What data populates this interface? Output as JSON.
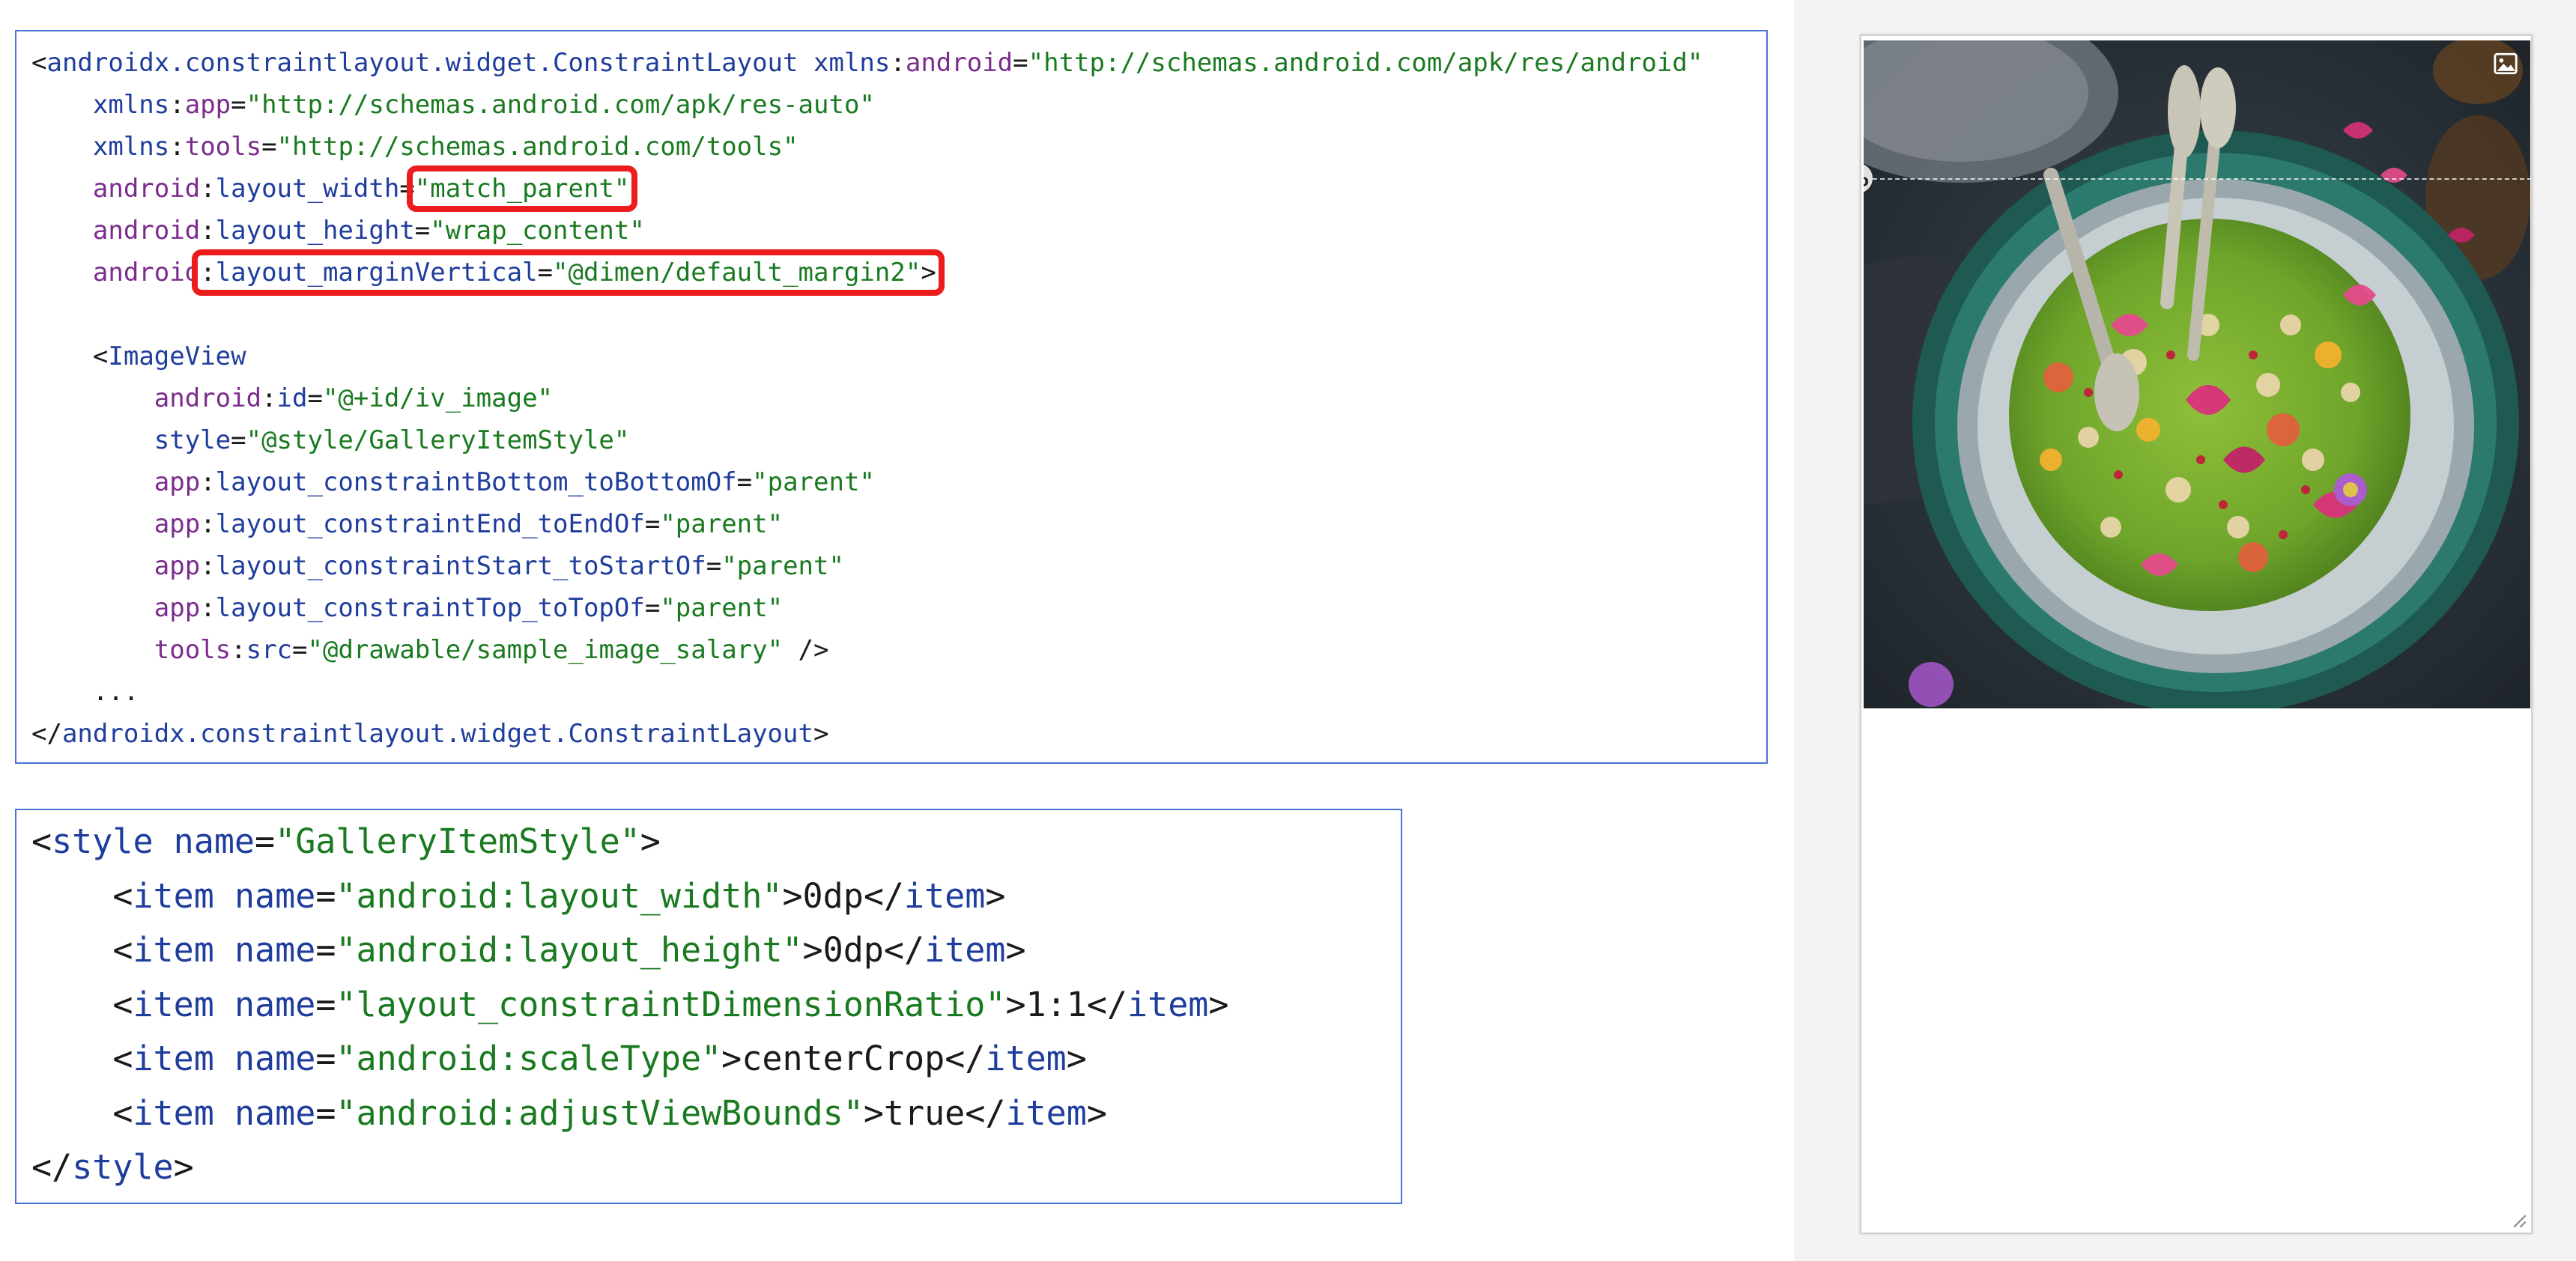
{
  "layout_xml": {
    "line1": {
      "open": "<",
      "tag": "androidx.constraintlayout.widget.ConstraintLayout",
      "sp": " ",
      "attr_ns": "xmlns",
      "attr_sep": ":",
      "attr_name": "android",
      "eq": "=",
      "value": "\"http://schemas.android.com/apk/res/android\""
    },
    "line2": {
      "ns": "xmlns",
      "sep": ":",
      "name": "app",
      "eq": "=",
      "value": "\"http://schemas.android.com/apk/res-auto\""
    },
    "line3": {
      "ns": "xmlns",
      "sep": ":",
      "name": "tools",
      "eq": "=",
      "value": "\"http://schemas.android.com/tools\""
    },
    "line4": {
      "ns": "android",
      "sep": ":",
      "name": "layout_width",
      "eq": "=",
      "value": "\"match_parent\""
    },
    "line5": {
      "ns": "android",
      "sep": ":",
      "name": "layout_height",
      "eq": "=",
      "value": "\"wrap_content\""
    },
    "line6": {
      "ns": "android",
      "sep": ":",
      "name": "layout_marginVertical",
      "eq": "=",
      "value": "\"@dimen/default_margin2\"",
      "close": ">"
    },
    "line8": {
      "open": "<",
      "tag": "ImageView"
    },
    "line9": {
      "ns": "android",
      "sep": ":",
      "name": "id",
      "eq": "=",
      "value": "\"@+id/iv_image\""
    },
    "line10": {
      "name": "style",
      "eq": "=",
      "value": "\"@style/GalleryItemStyle\""
    },
    "line11": {
      "ns": "app",
      "sep": ":",
      "name": "layout_constraintBottom_toBottomOf",
      "eq": "=",
      "value": "\"parent\""
    },
    "line12": {
      "ns": "app",
      "sep": ":",
      "name": "layout_constraintEnd_toEndOf",
      "eq": "=",
      "value": "\"parent\""
    },
    "line13": {
      "ns": "app",
      "sep": ":",
      "name": "layout_constraintStart_toStartOf",
      "eq": "=",
      "value": "\"parent\""
    },
    "line14": {
      "ns": "app",
      "sep": ":",
      "name": "layout_constraintTop_toTopOf",
      "eq": "=",
      "value": "\"parent\""
    },
    "line15": {
      "ns": "tools",
      "sep": ":",
      "name": "src",
      "eq": "=",
      "value": "\"@drawable/sample_image_salary\"",
      "close": " />"
    },
    "line16": {
      "text": "..."
    },
    "line17": {
      "open": "</",
      "tag": "androidx.constraintlayout.widget.ConstraintLayout",
      "close": ">"
    }
  },
  "style_xml": {
    "open_line": {
      "open": "<",
      "tag": "style",
      "attr": "name",
      "eq": "=",
      "value": "\"GalleryItemStyle\"",
      "close": ">"
    },
    "items": [
      {
        "name_value": "\"android:layout_width\"",
        "content": "0dp"
      },
      {
        "name_value": "\"android:layout_height\"",
        "content": "0dp"
      },
      {
        "name_value": "\"layout_constraintDimensionRatio\"",
        "content": "1:1"
      },
      {
        "name_value": "\"android:scaleType\"",
        "content": "centerCrop"
      },
      {
        "name_value": "\"android:adjustViewBounds\"",
        "content": "true"
      }
    ],
    "item_tag": "item",
    "item_attr": "name",
    "close_line": {
      "open": "</",
      "tag": "style",
      "close": ">"
    }
  },
  "preview": {
    "percent_label": "%",
    "image_icon": "image-icon",
    "image_subject": "food-bowl-photo"
  },
  "colors": {
    "highlight": "#ec1c1c",
    "box_border": "#4a73d6",
    "string": "#1a7a20",
    "tag": "#1f3d9c",
    "namespace": "#7b2c8c"
  }
}
